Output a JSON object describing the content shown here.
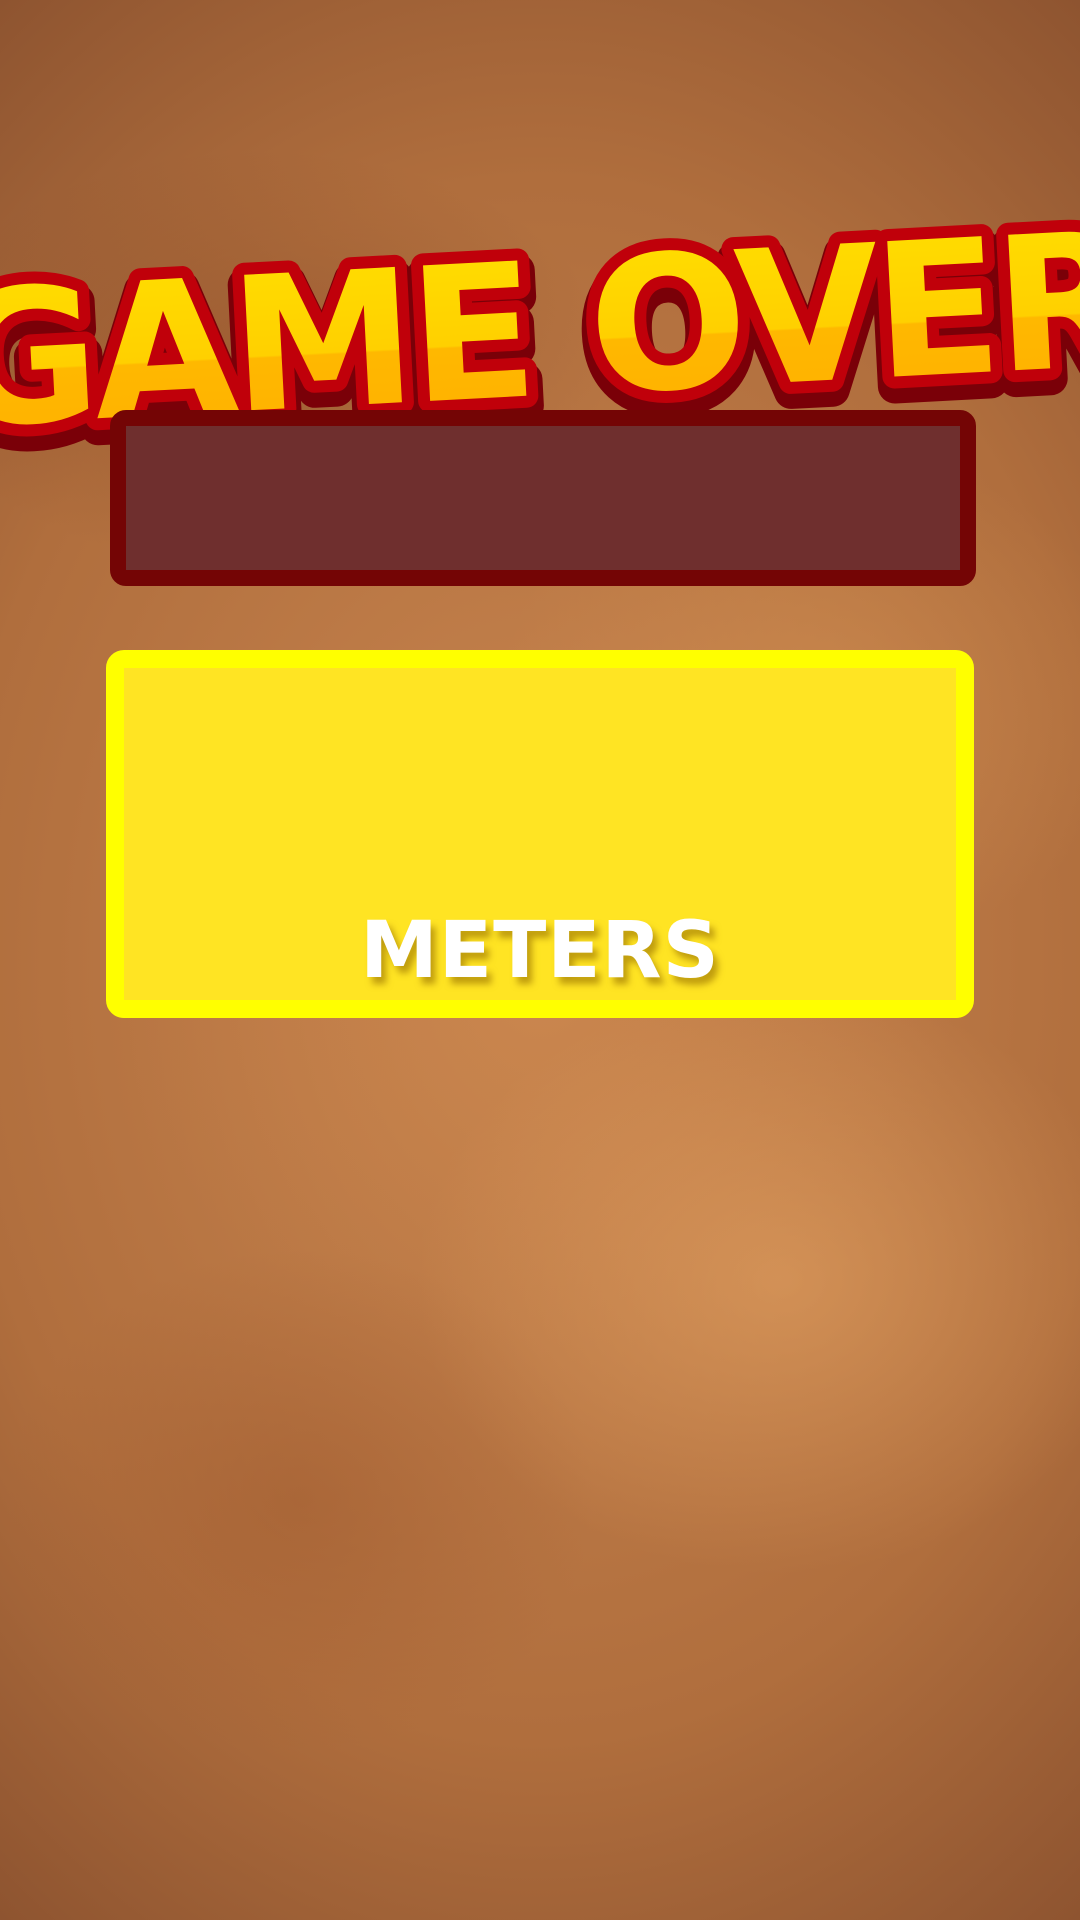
{
  "title": {
    "text": "GAME OVER"
  },
  "banner": {
    "text": ""
  },
  "score": {
    "value": "",
    "unit": "METERS"
  },
  "colors": {
    "title_fill": "#ffd200",
    "title_outline": "#c0000a",
    "banner_fill": "#6f2f2e",
    "banner_border": "#740505",
    "panel_fill": "#ffe423",
    "panel_border": "#ffff00",
    "score_text": "#ffffff"
  }
}
